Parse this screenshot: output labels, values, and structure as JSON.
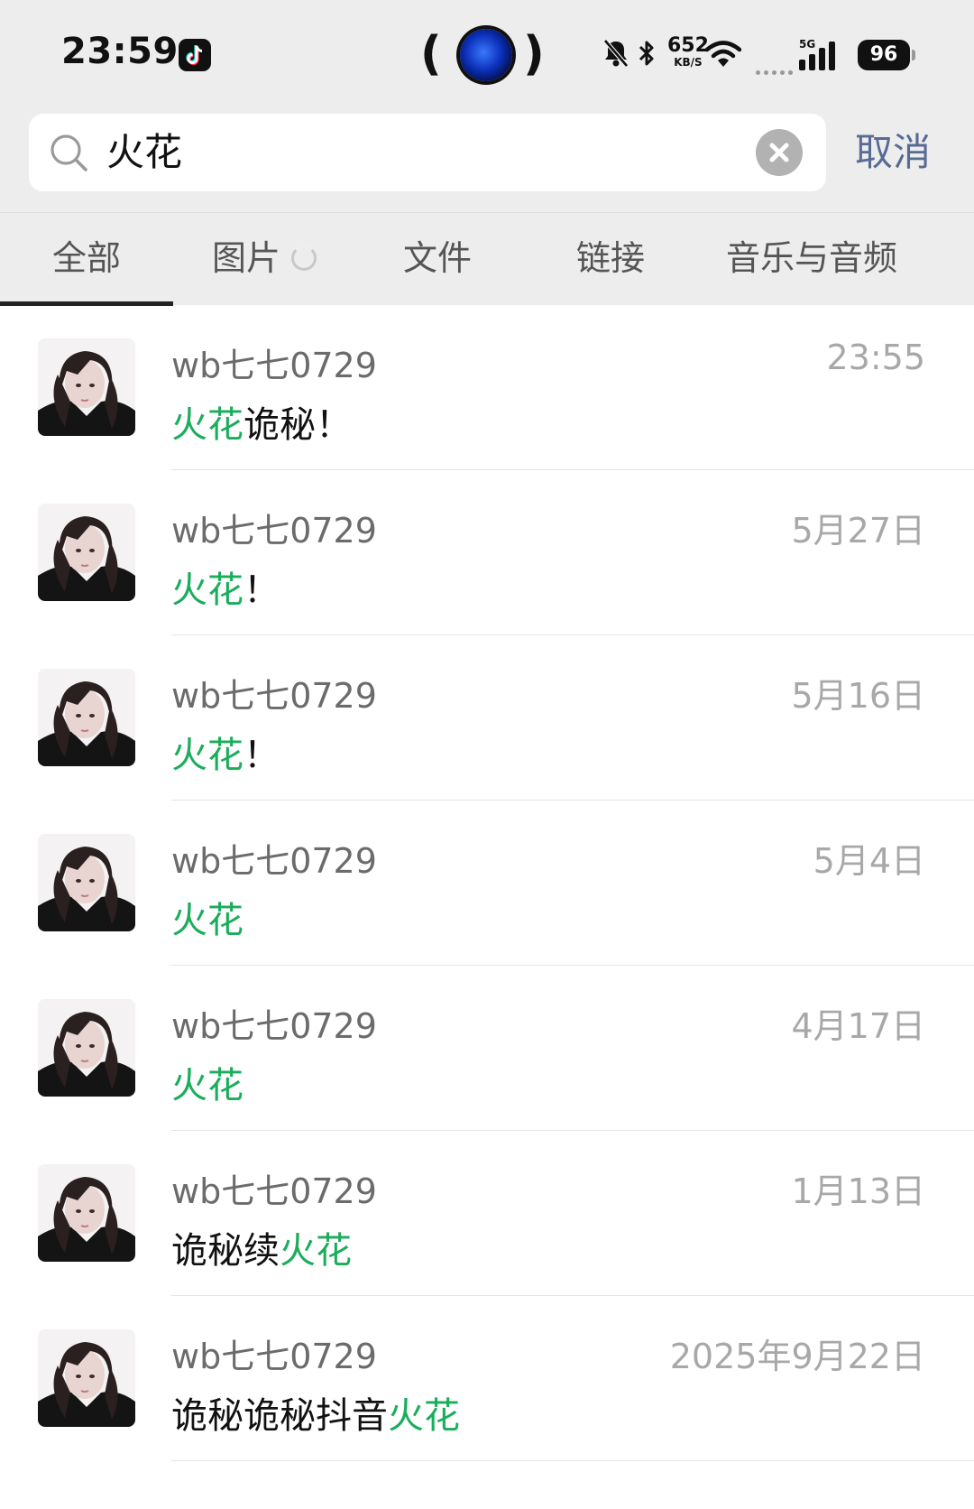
{
  "status_bar": {
    "time": "23:59",
    "net_speed": "652",
    "net_unit": "KB/S",
    "signal_type": "5G",
    "battery": "96",
    "icons": [
      "tiktok-icon",
      "mute-bell-icon",
      "bluetooth-icon",
      "wifi-icon",
      "cell-signal-icon",
      "battery-icon"
    ]
  },
  "search": {
    "query": "火花",
    "cancel_label": "取消"
  },
  "tabs": [
    {
      "label": "全部",
      "active": true
    },
    {
      "label": "图片",
      "loading": true
    },
    {
      "label": "文件"
    },
    {
      "label": "链接"
    },
    {
      "label": "音乐与音频"
    }
  ],
  "results": [
    {
      "name": "wb七七0729",
      "date": "23:55",
      "pre": "",
      "hl": "火花",
      "post": "诡秘！"
    },
    {
      "name": "wb七七0729",
      "date": "5月27日",
      "pre": "",
      "hl": "火花",
      "post": "！"
    },
    {
      "name": "wb七七0729",
      "date": "5月16日",
      "pre": "",
      "hl": "火花",
      "post": "！"
    },
    {
      "name": "wb七七0729",
      "date": "5月4日",
      "pre": "",
      "hl": "火花",
      "post": ""
    },
    {
      "name": "wb七七0729",
      "date": "4月17日",
      "pre": "",
      "hl": "火花",
      "post": ""
    },
    {
      "name": "wb七七0729",
      "date": "1月13日",
      "pre": "诡秘续",
      "hl": "火花",
      "post": ""
    },
    {
      "name": "wb七七0729",
      "date": "2025年9月22日",
      "pre": "诡秘诡秘抖音",
      "hl": "火花",
      "post": ""
    }
  ],
  "colors": {
    "highlight": "#1aad5a",
    "link": "#576b95",
    "header_bg": "#ededed"
  }
}
